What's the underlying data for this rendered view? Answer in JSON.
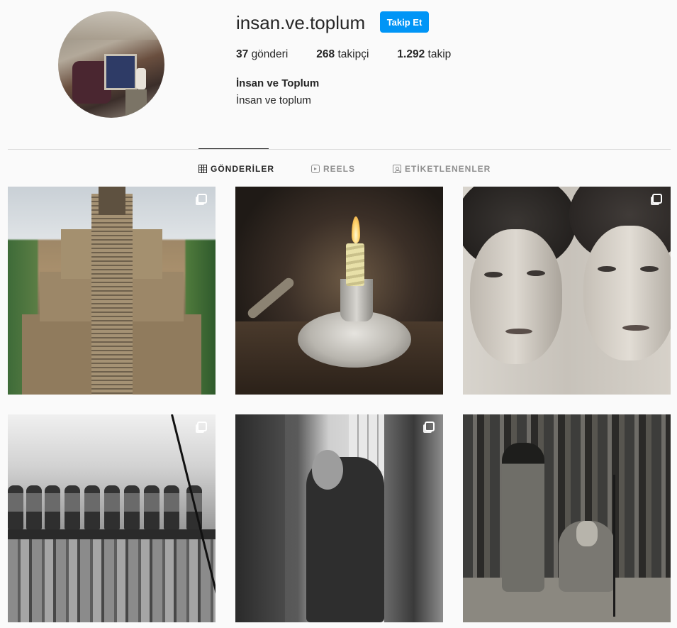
{
  "profile": {
    "username": "insan.ve.toplum",
    "follow_label": "Takip Et",
    "full_name": "İnsan ve Toplum",
    "bio": "İnsan ve toplum"
  },
  "stats": {
    "posts_count": "37",
    "posts_label": "gönderi",
    "followers_count": "268",
    "followers_label": "takipçi",
    "following_count": "1.292",
    "following_label": "takip"
  },
  "tabs": [
    {
      "label": "GÖNDERİLER",
      "icon": "grid-icon",
      "active": true
    },
    {
      "label": "REELS",
      "icon": "reels-icon",
      "active": false
    },
    {
      "label": "ETİKETLENENLER",
      "icon": "tag-icon",
      "active": false
    }
  ],
  "colors": {
    "accent": "#0095f6",
    "background": "#fafafa",
    "text": "#262626",
    "muted": "#8e8e8e"
  },
  "posts": [
    {
      "subject": "pyramid",
      "multi": true
    },
    {
      "subject": "candle",
      "multi": false
    },
    {
      "subject": "two-women-portrait",
      "multi": true
    },
    {
      "subject": "workers-on-beam",
      "multi": true
    },
    {
      "subject": "men-black-and-white",
      "multi": true
    },
    {
      "subject": "tribal-men-bamboo",
      "multi": false
    }
  ]
}
